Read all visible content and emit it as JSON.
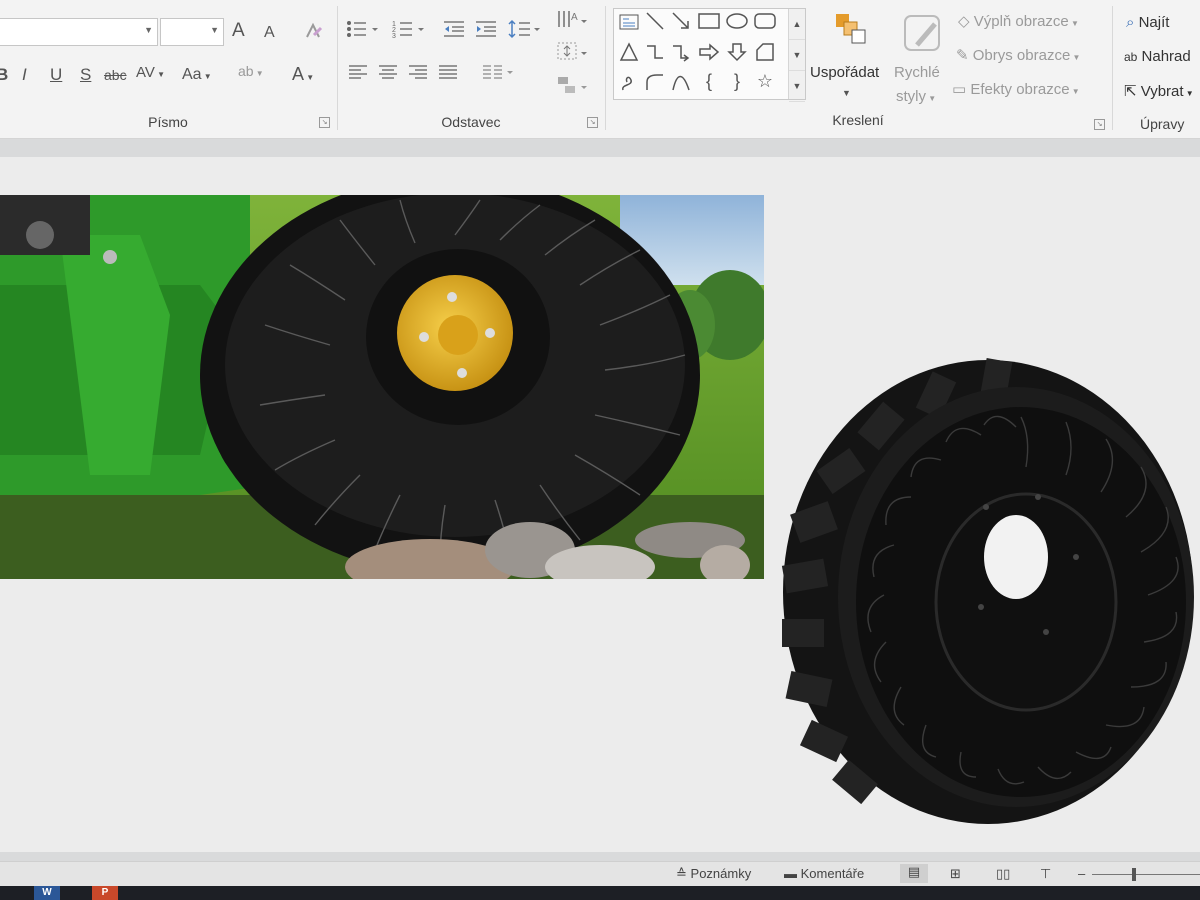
{
  "ribbon": {
    "font_group": {
      "label": "Písmo",
      "grow_label": "A",
      "shrink_label": "A",
      "format_buttons": [
        "B",
        "I",
        "U",
        "S",
        "abc",
        "AV",
        "Aa"
      ],
      "font_color_label": "A"
    },
    "paragraph_group": {
      "label": "Odstavec"
    },
    "drawing_group": {
      "label": "Kreslení",
      "arrange_label": "Uspořádat",
      "quick_styles_label_1": "Rychlé",
      "quick_styles_label_2": "styly",
      "shape_fill_label": "Výplň obrazce",
      "shape_outline_label": "Obrys obrazce",
      "shape_effects_label": "Efekty obrazce"
    },
    "editing_group": {
      "label": "Úpravy",
      "find_label": "Najít",
      "replace_label": "Nahrad",
      "select_label": "Vybrat"
    }
  },
  "slide": {
    "image_1": "mower-airless-tire-photo",
    "image_2": "airless-tire-photo"
  },
  "statusbar": {
    "notes_label": "Poznámky",
    "comments_label": "Komentáře"
  },
  "taskbar": {
    "apps": [
      "W",
      "P"
    ]
  },
  "colors": {
    "ribbon_bg": "#f3f3f3",
    "slide_bg": "#ececec",
    "hub_yellow": "#e8b21b",
    "mower_green": "#2e9a2a",
    "tire_black": "#151515",
    "taskbar_bg": "#1d1f25"
  }
}
